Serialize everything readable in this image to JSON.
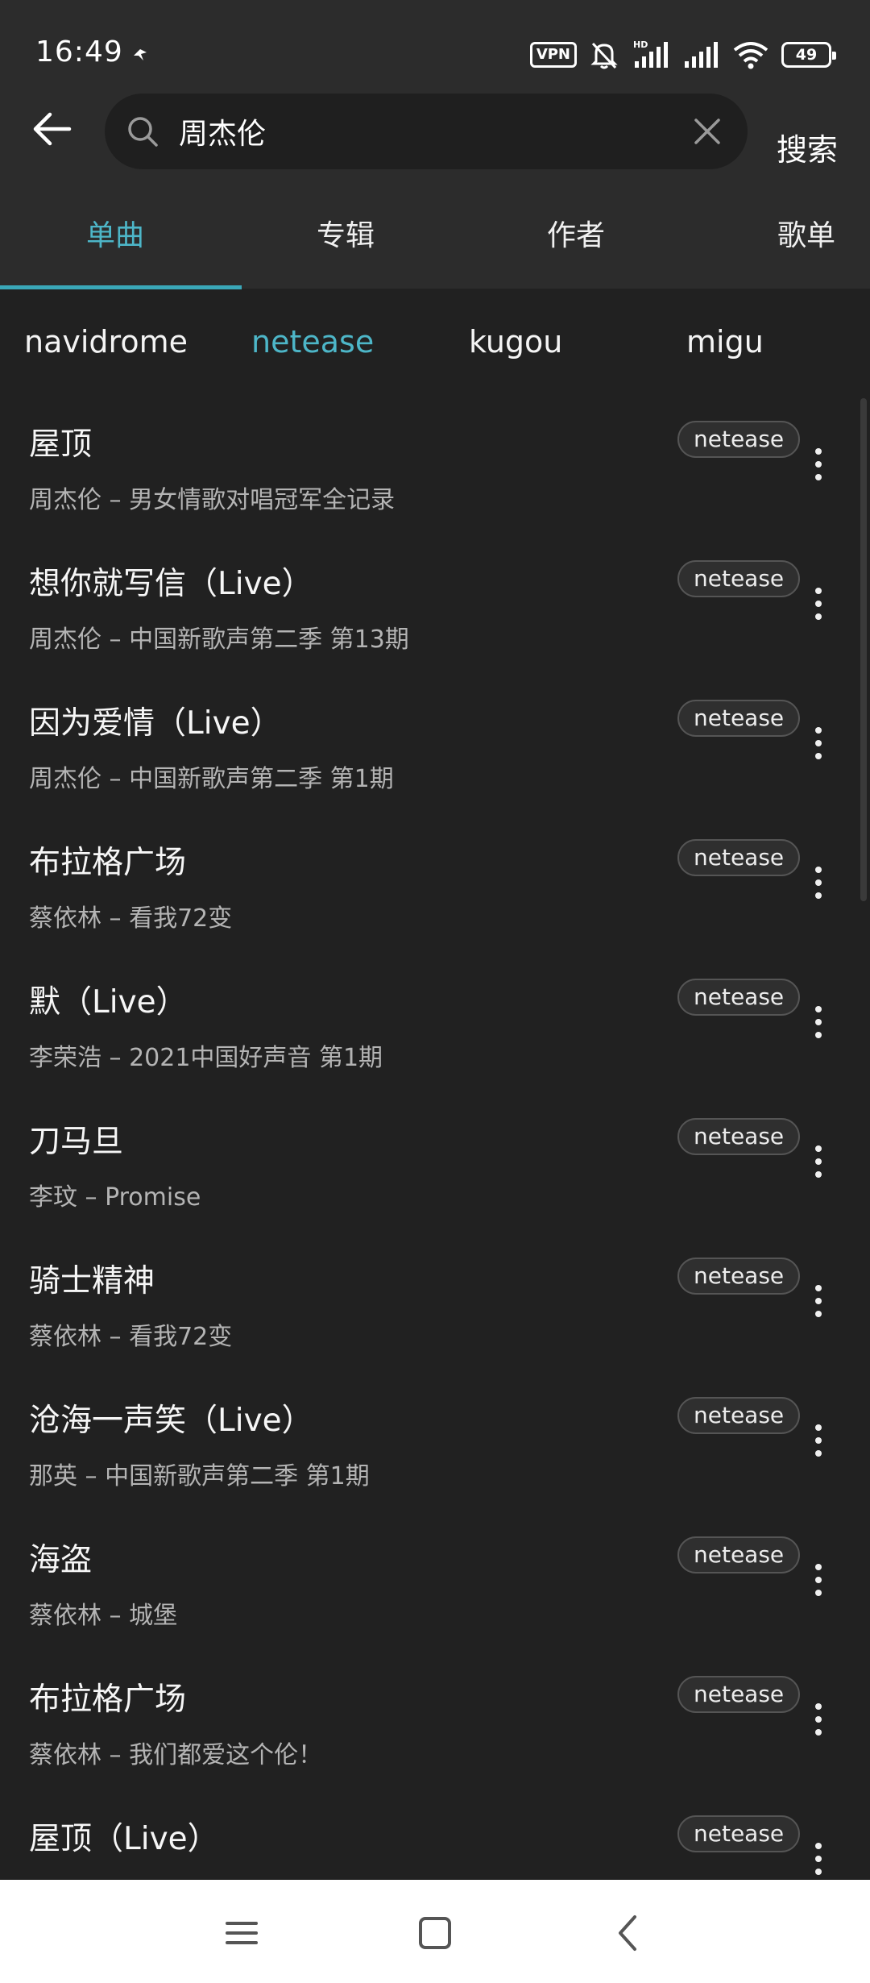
{
  "status_bar": {
    "time": "16:49",
    "vpn_label": "VPN",
    "battery_level": "49"
  },
  "search": {
    "query": "周杰伦",
    "submit_label": "搜索"
  },
  "tabs": [
    {
      "label": "单曲",
      "active": true
    },
    {
      "label": "专辑",
      "active": false
    },
    {
      "label": "作者",
      "active": false
    },
    {
      "label": "歌单",
      "active": false
    }
  ],
  "sources": [
    {
      "label": "navidrome",
      "active": false
    },
    {
      "label": "netease",
      "active": true
    },
    {
      "label": "kugou",
      "active": false
    },
    {
      "label": "migu",
      "active": false
    }
  ],
  "songs": [
    {
      "title": "屋顶",
      "subtitle": "周杰伦 – 男女情歌对唱冠军全记录",
      "source": "netease"
    },
    {
      "title": "想你就写信（Live）",
      "subtitle": "周杰伦 – 中国新歌声第二季 第13期",
      "source": "netease"
    },
    {
      "title": "因为爱情（Live）",
      "subtitle": "周杰伦 – 中国新歌声第二季 第1期",
      "source": "netease"
    },
    {
      "title": "布拉格广场",
      "subtitle": "蔡依林 – 看我72变",
      "source": "netease"
    },
    {
      "title": "默（Live）",
      "subtitle": "李荣浩 – 2021中国好声音 第1期",
      "source": "netease"
    },
    {
      "title": "刀马旦",
      "subtitle": "李玟 – Promise",
      "source": "netease"
    },
    {
      "title": "骑士精神",
      "subtitle": "蔡依林 – 看我72变",
      "source": "netease"
    },
    {
      "title": "沧海一声笑（Live）",
      "subtitle": "那英 – 中国新歌声第二季 第1期",
      "source": "netease"
    },
    {
      "title": "海盗",
      "subtitle": "蔡依林 – 城堡",
      "source": "netease"
    },
    {
      "title": "布拉格广场",
      "subtitle": "蔡依林 – 我们都爱这个伦！",
      "source": "netease"
    },
    {
      "title": "屋顶（Live）",
      "subtitle": "",
      "source": "netease"
    }
  ],
  "colors": {
    "accent": "#4db6c8",
    "background": "#212121",
    "header": "#2c2c2c"
  }
}
